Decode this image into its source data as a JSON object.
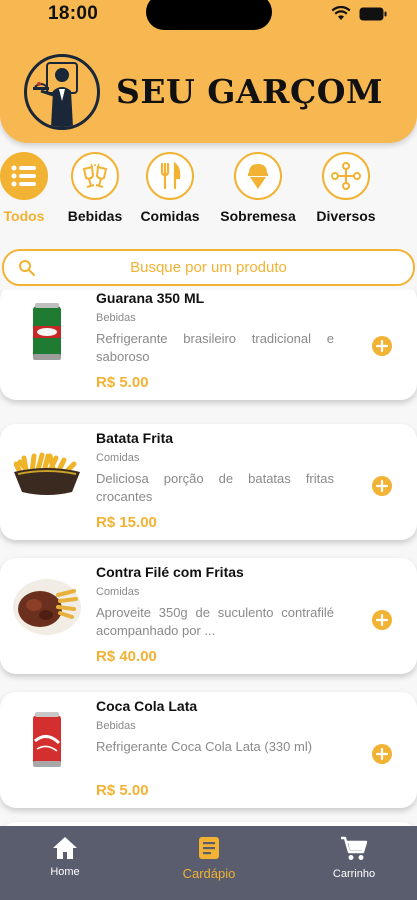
{
  "status_bar": {
    "time": "18:00"
  },
  "header": {
    "brand_title": "SEU GARÇOM"
  },
  "categories": [
    {
      "label": "Todos",
      "icon": "list-icon",
      "active": true
    },
    {
      "label": "Bebidas",
      "icon": "toast-glasses-icon",
      "active": false
    },
    {
      "label": "Comidas",
      "icon": "fork-knife-icon",
      "active": false
    },
    {
      "label": "Sobremesa",
      "icon": "ice-cream-icon",
      "active": false
    },
    {
      "label": "Diversos",
      "icon": "network-icon",
      "active": false
    }
  ],
  "search": {
    "placeholder": "Busque por um produto"
  },
  "products": [
    {
      "name": "Guarana 350 ML",
      "category": "Bebidas",
      "description": "Refrigerante brasileiro tradicional e saboroso",
      "price": "R$ 5.00",
      "image": "green-soda-can"
    },
    {
      "name": "Batata Frita",
      "category": "Comidas",
      "description": "Deliciosa porção de batatas fritas crocantes",
      "price": "R$ 15.00",
      "image": "fries-basket"
    },
    {
      "name": "Contra Filé com Fritas",
      "category": "Comidas",
      "description": "Aproveite 350g de suculento contrafilé acompanhado por ...",
      "price": "R$ 40.00",
      "image": "steak-plate"
    },
    {
      "name": "Coca Cola Lata",
      "category": "Bebidas",
      "description": "Refrigerante Coca Cola Lata (330 ml)",
      "price": "R$ 5.00",
      "image": "red-soda-can"
    }
  ],
  "bottom_nav": [
    {
      "label": "Home",
      "icon": "home-icon",
      "active": false
    },
    {
      "label": "Cardápio",
      "icon": "menu-book-icon",
      "active": true
    },
    {
      "label": "Carrinho",
      "icon": "cart-icon",
      "active": false
    }
  ],
  "colors": {
    "accent": "#f2b233",
    "header": "#f7b851",
    "nav_bg": "#5a5d6e"
  }
}
